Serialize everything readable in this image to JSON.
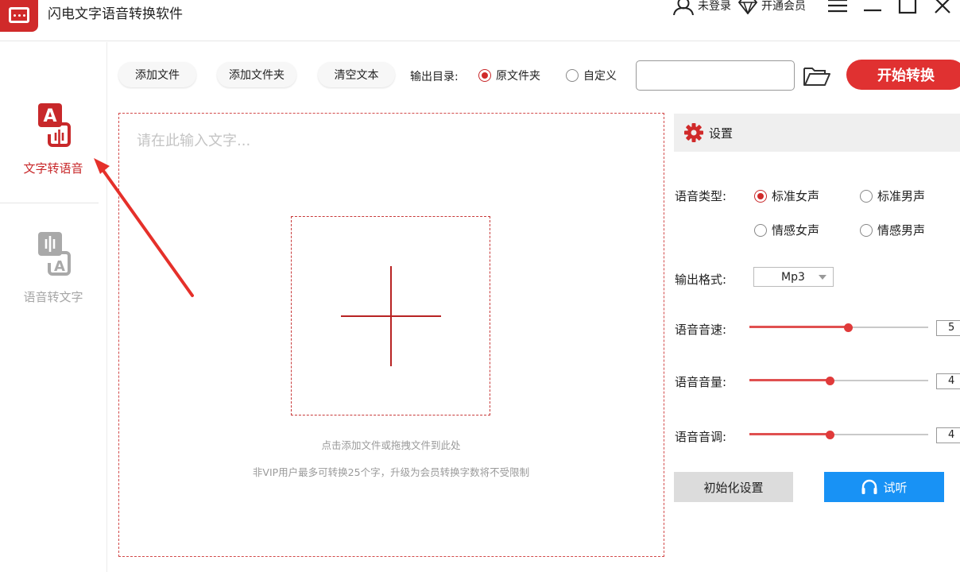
{
  "app": {
    "title": "闪电文字语音转换软件",
    "user_label": "未登录",
    "vip_label": "开通会员"
  },
  "sidebar": {
    "items": [
      {
        "label": "文字转语音",
        "icon": "text-to-speech-icon",
        "active": true
      },
      {
        "label": "语音转文字",
        "icon": "speech-to-text-icon",
        "active": false
      }
    ]
  },
  "toolbar": {
    "add_file": "添加文件",
    "add_folder": "添加文件夹",
    "clear_text": "清空文本",
    "output_dir_label": "输出目录:",
    "option_original": "原文件夹",
    "option_custom": "自定义",
    "output_path_value": "",
    "start_label": "开始转换"
  },
  "editor": {
    "placeholder": "请在此输入文字...",
    "hint_drop": "点击添加文件或拖拽文件到此处",
    "hint_vip": "非VIP用户最多可转换25个字，升级为会员转换字数将不受限制"
  },
  "settings": {
    "title": "设置",
    "voice_type_label": "语音类型:",
    "voice_options": [
      {
        "label": "标准女声",
        "selected": true
      },
      {
        "label": "标准男声",
        "selected": false
      },
      {
        "label": "情感女声",
        "selected": false
      },
      {
        "label": "情感男声",
        "selected": false
      }
    ],
    "format_label": "输出格式:",
    "format_value": "Mp3",
    "speed_label": "语音音速:",
    "speed_value": "5",
    "speed_fraction": 0.55,
    "volume_label": "语音音量:",
    "volume_value": "4",
    "volume_fraction": 0.45,
    "pitch_label": "语音音调:",
    "pitch_value": "4",
    "pitch_fraction": 0.45,
    "reset_label": "初始化设置",
    "listen_label": "试听"
  },
  "colors": {
    "brand_red": "#d02a2a",
    "listen_blue": "#1892f5"
  }
}
